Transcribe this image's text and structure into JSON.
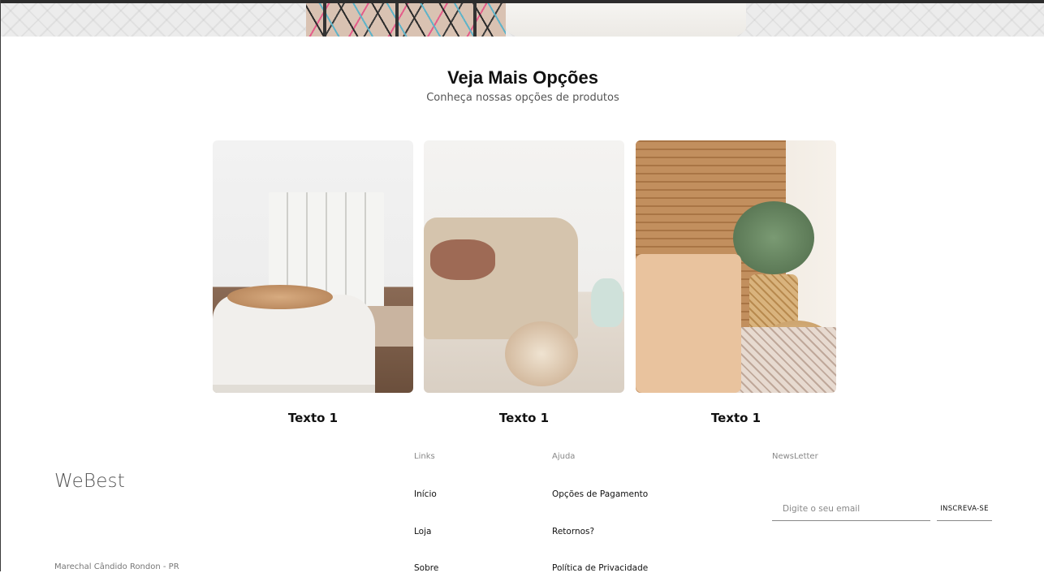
{
  "section": {
    "title": "Veja Mais Opções",
    "subtitle": "Conheça nossas opções de produtos"
  },
  "cards": [
    {
      "label": "Texto 1"
    },
    {
      "label": "Texto 1"
    },
    {
      "label": "Texto 1"
    }
  ],
  "footer": {
    "brand": "WeBest",
    "address": "Marechal Cândido Rondon - PR",
    "links": {
      "heading": "Links",
      "items": [
        "Início",
        "Loja",
        "Sobre"
      ]
    },
    "help": {
      "heading": "Ajuda",
      "items": [
        "Opções de Pagamento",
        "Retornos?",
        "Política de Privacidade"
      ]
    },
    "newsletter": {
      "heading": "NewsLetter",
      "placeholder": "Digite o seu email",
      "value": "",
      "button_label": "INSCREVA-SE"
    }
  }
}
